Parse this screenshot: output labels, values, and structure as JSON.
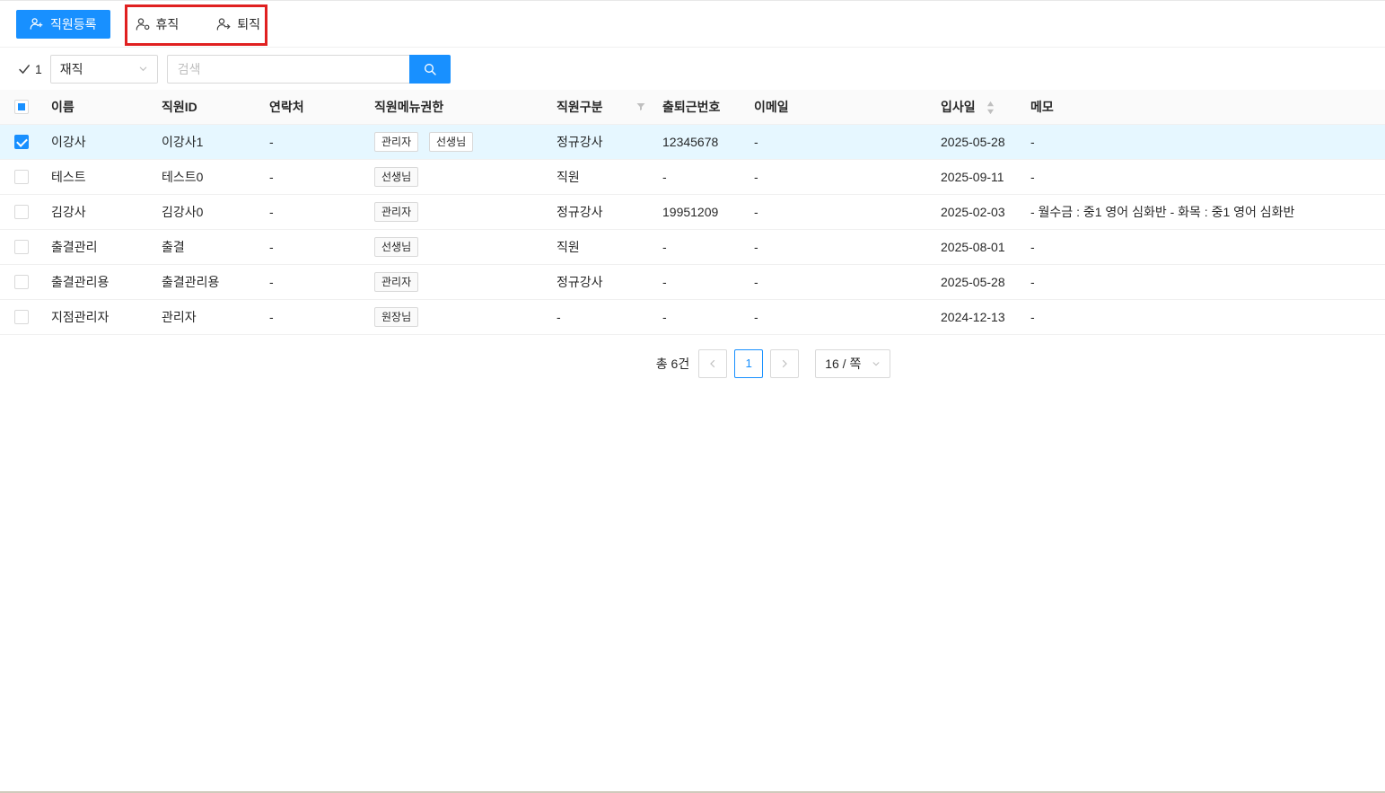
{
  "toolbar": {
    "register_label": "직원등록",
    "leave_label": "휴직",
    "resign_label": "퇴직"
  },
  "filter_bar": {
    "selected_count": "1",
    "status_value": "재직",
    "search_placeholder": "검색"
  },
  "table": {
    "columns": {
      "name": "이름",
      "id": "직원ID",
      "contact": "연락처",
      "permissions": "직원메뉴권한",
      "category": "직원구분",
      "attendance_no": "출퇴근번호",
      "email": "이메일",
      "join_date": "입사일",
      "memo": "메모"
    },
    "rows": [
      {
        "checked": true,
        "name": "이강사",
        "id": "이강사1",
        "contact": "-",
        "permissions": [
          "관리자",
          "선생님"
        ],
        "category": "정규강사",
        "attendance_no": "12345678",
        "email": "-",
        "join_date": "2025-05-28",
        "memo": "-"
      },
      {
        "checked": false,
        "name": "테스트",
        "id": "테스트0",
        "contact": "-",
        "permissions": [
          "선생님"
        ],
        "category": "직원",
        "attendance_no": "-",
        "email": "-",
        "join_date": "2025-09-11",
        "memo": "-"
      },
      {
        "checked": false,
        "name": "김강사",
        "id": "김강사0",
        "contact": "-",
        "permissions": [
          "관리자"
        ],
        "category": "정규강사",
        "attendance_no": "19951209",
        "email": "-",
        "join_date": "2025-02-03",
        "memo": "- 월수금 : 중1 영어 심화반 - 화목 : 중1 영어 심화반"
      },
      {
        "checked": false,
        "name": "출결관리",
        "id": "출결",
        "contact": "-",
        "permissions": [
          "선생님"
        ],
        "category": "직원",
        "attendance_no": "-",
        "email": "-",
        "join_date": "2025-08-01",
        "memo": "-"
      },
      {
        "checked": false,
        "name": "출결관리용",
        "id": "출결관리용",
        "contact": "-",
        "permissions": [
          "관리자"
        ],
        "category": "정규강사",
        "attendance_no": "-",
        "email": "-",
        "join_date": "2025-05-28",
        "memo": "-"
      },
      {
        "checked": false,
        "name": "지점관리자",
        "id": "관리자",
        "contact": "-",
        "permissions": [
          "원장님"
        ],
        "category": "-",
        "attendance_no": "-",
        "email": "-",
        "join_date": "2024-12-13",
        "memo": "-"
      }
    ]
  },
  "pagination": {
    "total_label": "총 6건",
    "prev_label": "<",
    "next_label": ">",
    "current_page": "1",
    "page_size_label": "16 / 쪽"
  },
  "colors": {
    "primary": "#1890ff",
    "annotation_red": "#e02020",
    "selected_row_bg": "#e6f7ff",
    "header_bg": "#fafafa",
    "border": "#f0f0f0"
  }
}
